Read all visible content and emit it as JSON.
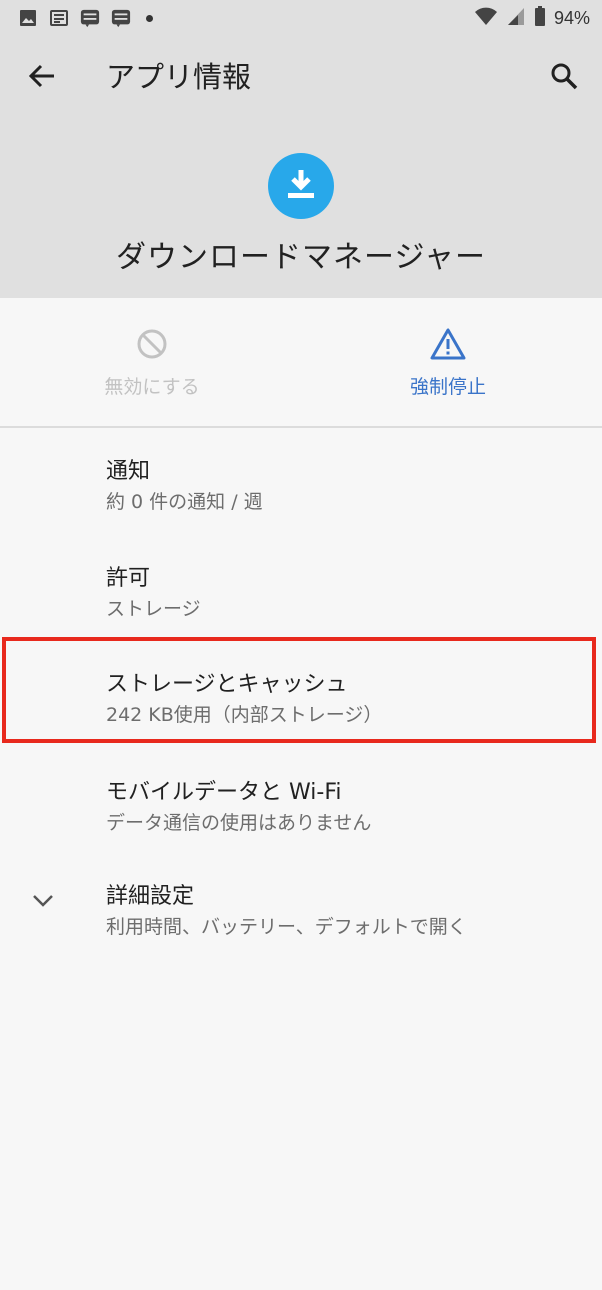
{
  "status_bar": {
    "battery": "94%",
    "left_icons": [
      "image-icon",
      "news-icon",
      "line-manga-icon",
      "line-manga-icon",
      "dot-icon"
    ],
    "right_icons": [
      "wifi-icon",
      "signal-icon",
      "battery-icon"
    ]
  },
  "toolbar": {
    "title": "アプリ情報"
  },
  "app": {
    "name": "ダウンロードマネージャー",
    "icon_color": "#28a8ea"
  },
  "actions": {
    "disable_label": "無効にする",
    "force_stop_label": "強制停止",
    "accent": "#3a74c9"
  },
  "items": [
    {
      "title": "通知",
      "subtitle": "約 0 件の通知 / 週"
    },
    {
      "title": "許可",
      "subtitle": "ストレージ"
    },
    {
      "title": "ストレージとキャッシュ",
      "subtitle": "242 KB使用（内部ストレージ）"
    },
    {
      "title": "モバイルデータと Wi-Fi",
      "subtitle": "データ通信の使用はありません"
    },
    {
      "title": "詳細設定",
      "subtitle": "利用時間、バッテリー、デフォルトで開く"
    }
  ],
  "highlight_color": "#e8291d"
}
